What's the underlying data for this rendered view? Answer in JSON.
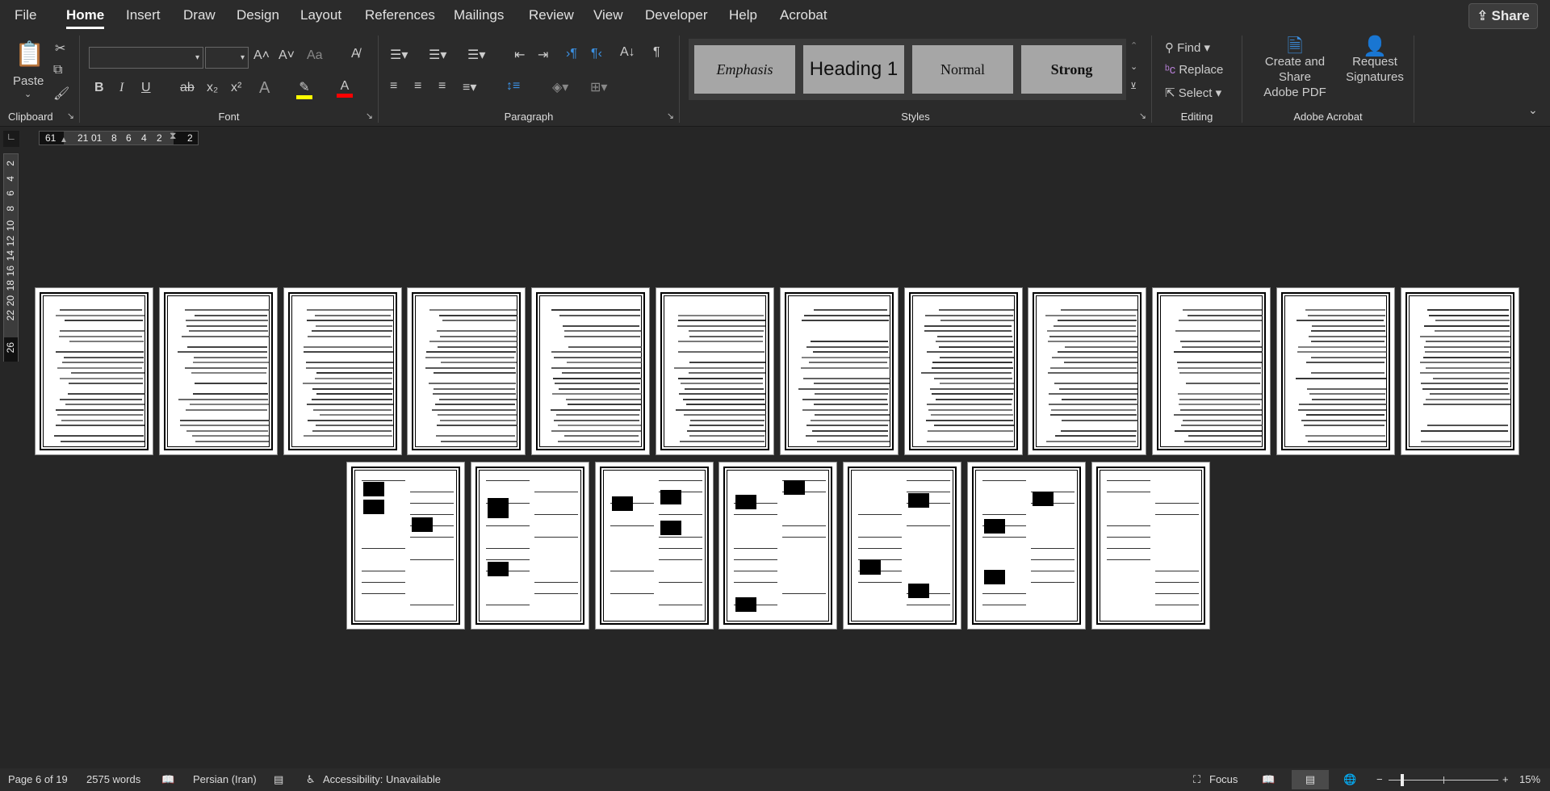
{
  "tabs": [
    "File",
    "Home",
    "Insert",
    "Draw",
    "Design",
    "Layout",
    "References",
    "Mailings",
    "Review",
    "View",
    "Developer",
    "Help",
    "Acrobat"
  ],
  "active_tab": "Home",
  "share_label": "Share",
  "clipboard": {
    "paste": "Paste",
    "label": "Clipboard"
  },
  "font": {
    "label": "Font",
    "name": "",
    "size": "",
    "grow": "A˄",
    "shrink": "A˅",
    "case": "Aa",
    "bold": "B",
    "italic": "I",
    "underline": "U",
    "strike": "ab",
    "sub": "x₂",
    "sup": "x²",
    "highlight_color": "#ffff00",
    "font_color": "#ff0000"
  },
  "paragraph": {
    "label": "Paragraph"
  },
  "styles": {
    "label": "Styles",
    "items": [
      "Emphasis",
      "Heading 1",
      "Normal",
      "Strong"
    ]
  },
  "editing": {
    "label": "Editing",
    "find": "Find",
    "replace": "Replace",
    "select": "Select"
  },
  "acrobat": {
    "label": "Adobe Acrobat",
    "create_line1": "Create and Share",
    "create_line2": "Adobe PDF",
    "request_line1": "Request",
    "request_line2": "Signatures",
    "accent": "#3b8fe0"
  },
  "ruler": {
    "h": [
      "61",
      "21",
      "01",
      "8",
      "6",
      "4",
      "2",
      "2"
    ],
    "v": [
      "2",
      "4",
      "6",
      "8",
      "10",
      "12",
      "14",
      "16",
      "18",
      "20",
      "22",
      "26"
    ]
  },
  "status": {
    "page": "Page 6 of 19",
    "words": "2575 words",
    "language": "Persian (Iran)",
    "accessibility": "Accessibility: Unavailable",
    "focus": "Focus",
    "zoom": "15%",
    "zoom_level": 15
  }
}
